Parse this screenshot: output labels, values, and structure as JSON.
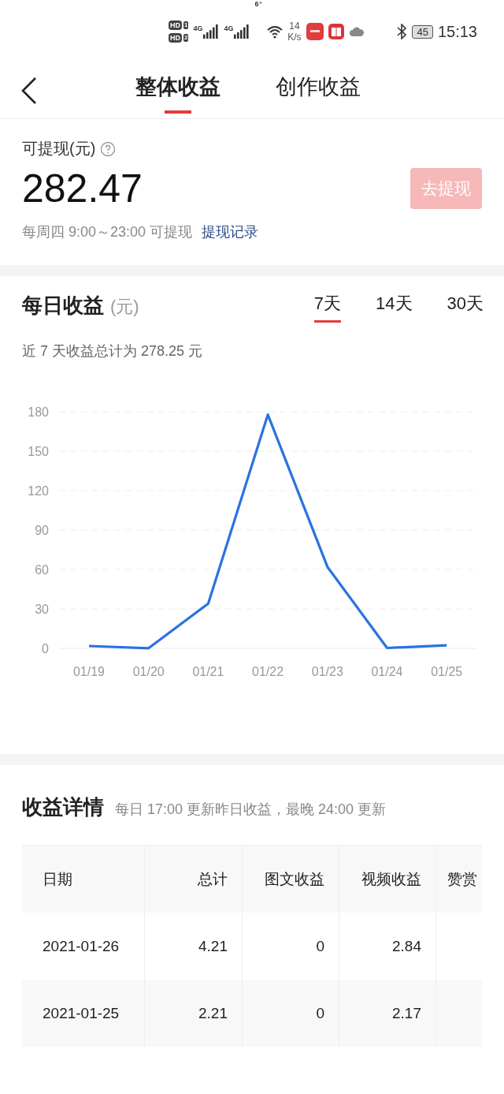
{
  "status_bar": {
    "sims": [
      {
        "badge": "HD",
        "slot": "1"
      },
      {
        "badge": "HD",
        "slot": "2"
      }
    ],
    "networks": [
      {
        "label": "4G"
      },
      {
        "label": "4G"
      }
    ],
    "wifi_label": "6⁺",
    "net_speed": [
      "14",
      "K/s"
    ],
    "battery": "45",
    "time": "15:13"
  },
  "nav": {
    "tabs": [
      {
        "label": "整体收益",
        "selected": true
      },
      {
        "label": "创作收益",
        "selected": false
      }
    ]
  },
  "balance": {
    "label": "可提现(元)",
    "amount": "282.47",
    "withdraw_button": {
      "label": "去提现",
      "disabled": true
    },
    "note": "每周四 9:00～23:00 可提现",
    "record_link": "提现记录"
  },
  "daily": {
    "title": "每日收益",
    "unit": "(元)",
    "periods": [
      {
        "label": "7天",
        "selected": true
      },
      {
        "label": "14天",
        "selected": false
      },
      {
        "label": "30天",
        "selected": false
      }
    ],
    "summary": "近 7 天收益总计为 278.25 元",
    "chart_data": {
      "type": "line",
      "categories": [
        "01/19",
        "01/20",
        "01/21",
        "01/22",
        "01/23",
        "01/24",
        "01/25"
      ],
      "series": [
        {
          "color": "#2a72e0",
          "values": [
            1.8,
            0.1,
            34,
            177.8,
            62,
            0.3,
            2.3
          ]
        }
      ],
      "ylim": [
        0,
        180
      ],
      "grid": true,
      "yticks": [
        0,
        30,
        60,
        90,
        120,
        150,
        180
      ]
    }
  },
  "details": {
    "title": "收益详情",
    "note": "每日 17:00 更新昨日收益，最晚 24:00 更新",
    "columns": [
      "日期",
      "总计",
      "图文收益",
      "视频收益",
      "赞赏"
    ],
    "rows": [
      [
        "2021-01-26",
        "4.21",
        "0",
        "2.84"
      ],
      [
        "2021-01-25",
        "2.21",
        "0",
        "2.17"
      ]
    ]
  }
}
